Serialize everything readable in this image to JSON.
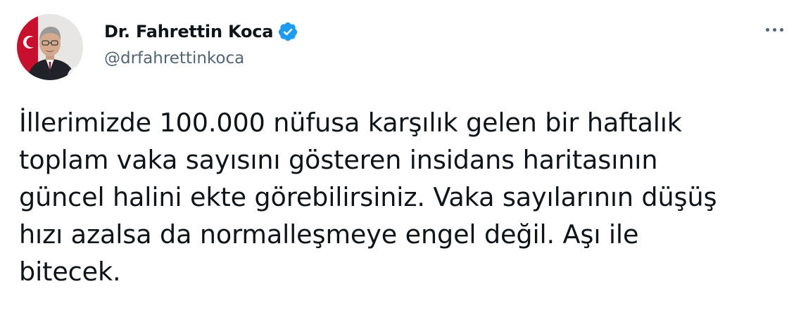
{
  "author": {
    "display_name": "Dr. Fahrettin Koca",
    "handle": "@drfahrettinkoca",
    "verified": true,
    "verified_color": "#1d9bf0"
  },
  "menu": {
    "icon": "more-horizontal-icon"
  },
  "tweet": {
    "lines": [
      "İllerimizde 100.000 nüfusa karşılık gelen bir haftalık",
      "toplam vaka sayısını gösteren insidans haritasının",
      "güncel halini ekte görebilirsiniz. Vaka sayılarının düşüş",
      "hızı azalsa da normalleşmeye engel değil. Aşı ile",
      "bitecek."
    ]
  },
  "colors": {
    "text_primary": "#0f1419",
    "text_secondary": "#536471",
    "background": "#ffffff"
  }
}
